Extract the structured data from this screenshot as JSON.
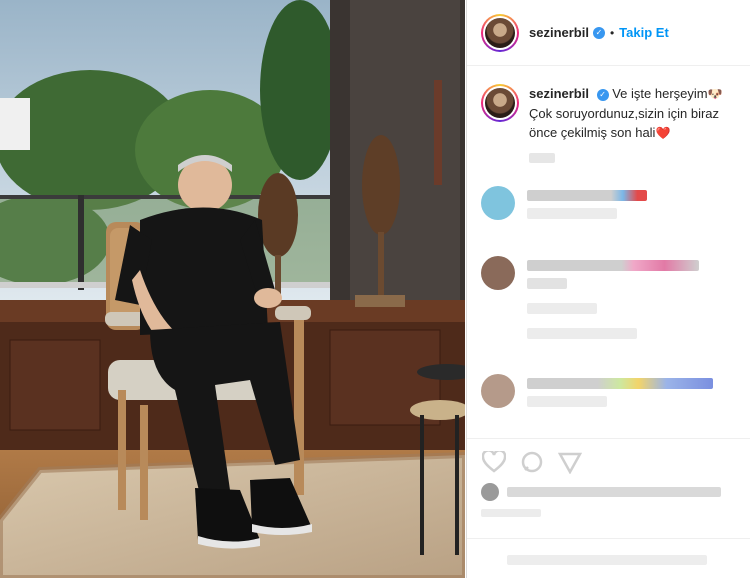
{
  "post": {
    "username": "sezinerbil",
    "verified": true,
    "follow_label": "Takip Et",
    "dot": "•",
    "caption": {
      "part1": "Ve işte herşeyim",
      "emoji1": "🐶",
      "part2": "Çok soruyordunuz,sizin için biraz önce çekilmiş son hali",
      "emoji2": "❤️"
    }
  },
  "icons": {
    "verified": "verified-badge-icon",
    "like": "heart-icon",
    "comment": "comment-icon",
    "share": "share-icon"
  },
  "colors": {
    "link_blue": "#0095f6",
    "verified_blue": "#3897f0"
  }
}
